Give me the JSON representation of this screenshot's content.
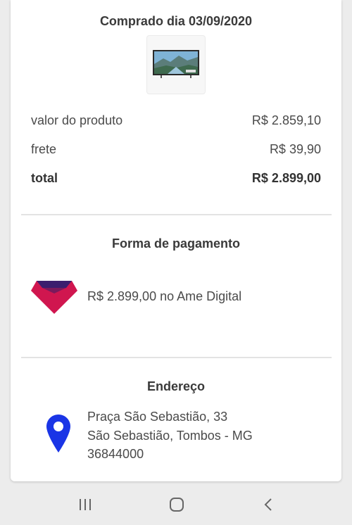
{
  "order": {
    "purchase_date": "Comprado dia 03/09/2020",
    "product_image": "tv-product-image"
  },
  "summary": {
    "rows": [
      {
        "label": "valor do produto",
        "value": "R$ 2.859,10"
      },
      {
        "label": "frete",
        "value": "R$ 39,90"
      },
      {
        "label": "total",
        "value": "R$ 2.899,00"
      }
    ]
  },
  "payment": {
    "title": "Forma de pagamento",
    "icon": "ame-digital-logo",
    "text": "R$ 2.899,00 no Ame Digital"
  },
  "address": {
    "title": "Endereço",
    "icon": "location-pin-icon",
    "lines": [
      "Praça São Sebastião, 33",
      "São Sebastião, Tombos - MG",
      "36844000"
    ]
  },
  "navbar": {
    "buttons": [
      "recent-apps-icon",
      "home-icon",
      "back-icon"
    ]
  },
  "colors": {
    "pin": "#1a35e6",
    "ame_red": "#d0164f",
    "ame_purple": "#3b1e6e",
    "background": "#ececec",
    "card": "#ffffff"
  }
}
